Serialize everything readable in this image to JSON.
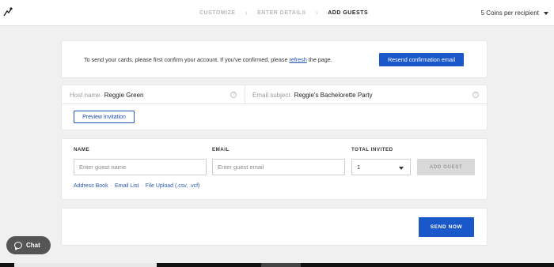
{
  "header": {
    "steps": [
      "CUSTOMIZE",
      "ENTER DETAILS",
      "ADD GUESTS"
    ],
    "separator": "›",
    "coins_label": "5 Coins per recipient"
  },
  "confirm": {
    "text_before": "To send your cards, please first confirm your account. If you've confirmed, please ",
    "link": "refresh",
    "text_after": " the page.",
    "button": "Resend confirmation email"
  },
  "event": {
    "host_label": "Host name",
    "host_value": "Reggie Green",
    "subject_label": "Email subject",
    "subject_value": "Reggie's Bachelorette Party",
    "help_glyph": "?",
    "preview_button": "Preview Invitation"
  },
  "guests": {
    "name_header": "NAME",
    "email_header": "EMAIL",
    "total_header": "TOTAL INVITED",
    "name_placeholder": "Enter guest name",
    "email_placeholder": "Enter guest email",
    "total_value": "1",
    "add_button": "ADD GUEST",
    "links": [
      "Address Book",
      "Email List",
      "File Upload (.csv, .vcf)"
    ],
    "link_sep": "·"
  },
  "send": {
    "button": "SEND NOW"
  },
  "chat": {
    "label": "Chat"
  }
}
